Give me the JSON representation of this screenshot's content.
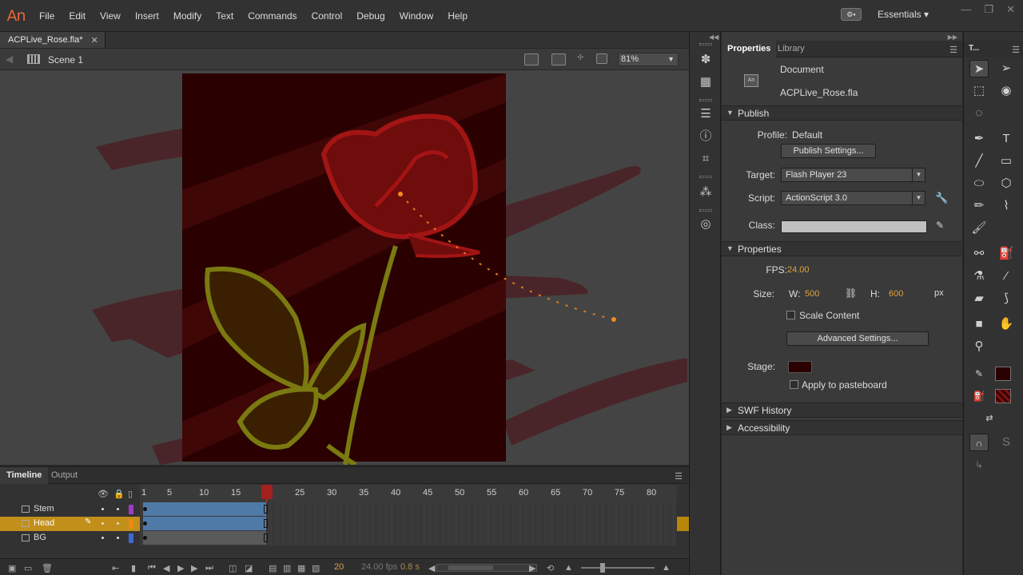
{
  "app": {
    "logo": "An",
    "menu": [
      "File",
      "Edit",
      "View",
      "Insert",
      "Modify",
      "Text",
      "Commands",
      "Control",
      "Debug",
      "Window",
      "Help"
    ],
    "workspace": "Essentials",
    "window_controls": {
      "minimize": "—",
      "restore": "❐",
      "close": "✕"
    }
  },
  "document": {
    "tab_title": "ACPLive_Rose.fla*",
    "scene": "Scene 1",
    "zoom": "81%"
  },
  "timeline": {
    "tabs": [
      "Timeline",
      "Output"
    ],
    "ruler_numbers": [
      "1",
      "5",
      "10",
      "15",
      "20",
      "25",
      "30",
      "35",
      "40",
      "45",
      "50",
      "55",
      "60",
      "65",
      "70",
      "75",
      "80"
    ],
    "current_frame_marker": "20",
    "layers": [
      {
        "name": "Stem",
        "color": "#9c3bc4",
        "selected": false
      },
      {
        "name": "Head",
        "color": "#e98a12",
        "selected": true
      },
      {
        "name": "BG",
        "color": "#3d68d6",
        "selected": false
      }
    ],
    "footer": {
      "current_frame": "20",
      "fps": "24.00 fps",
      "elapsed": "0.8 s"
    }
  },
  "properties": {
    "tabs": [
      "Properties",
      "Library"
    ],
    "doc_type": "Document",
    "doc_name": "ACPLive_Rose.fla",
    "doc_icon_text": "An",
    "publish": {
      "header": "Publish",
      "profile_label": "Profile:",
      "profile_value": "Default",
      "settings_button": "Publish Settings...",
      "target_label": "Target:",
      "target_value": "Flash Player 23",
      "script_label": "Script:",
      "script_value": "ActionScript 3.0",
      "class_label": "Class:"
    },
    "props": {
      "header": "Properties",
      "fps_label": "FPS:",
      "fps_value": "24.00",
      "size_label": "Size:",
      "w_label": "W:",
      "w_value": "500",
      "h_label": "H:",
      "h_value": "600",
      "unit": "px",
      "scale_content": "Scale Content",
      "advanced_button": "Advanced Settings...",
      "stage_label": "Stage:",
      "stage_color": "#2a0000",
      "apply_pasteboard": "Apply to pasteboard"
    },
    "collapsed_sections": [
      "SWF History",
      "Accessibility"
    ]
  },
  "tools": {
    "title": "T..."
  }
}
